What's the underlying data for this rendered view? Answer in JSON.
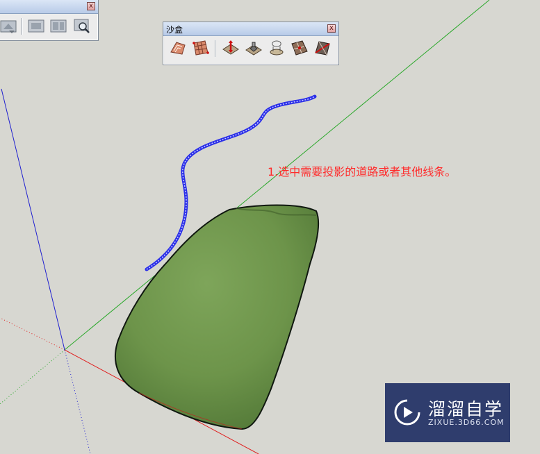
{
  "toolbars": {
    "sandbox": {
      "title": "沙盒",
      "close_glyph": "x",
      "tools": [
        {
          "name": "from-contours-tool-icon"
        },
        {
          "name": "from-scratch-tool-icon"
        },
        {
          "name": "smoove-tool-icon"
        },
        {
          "name": "stamp-tool-icon"
        },
        {
          "name": "drape-tool-icon"
        },
        {
          "name": "add-detail-tool-icon"
        },
        {
          "name": "flip-edge-tool-icon"
        }
      ]
    },
    "views": {
      "close_glyph": "x",
      "tools": [
        {
          "name": "view-tool-icon"
        },
        {
          "name": "view-tool-icon"
        },
        {
          "name": "view-tool-icon"
        },
        {
          "name": "zoom-view-tool-icon"
        }
      ]
    }
  },
  "annotation": {
    "text": "1.选中需要投影的道路或者其他线条。",
    "color": "#ff2b2b"
  },
  "watermark": {
    "title": "溜溜自学",
    "url": "ZIXUE.3D66.COM",
    "background": "#2f3d6d"
  },
  "scene": {
    "background": "#d7d7d1",
    "terrain_color": "#6d944a",
    "road_line_color": "#2a2ee8",
    "axis_colors": {
      "red": "#e01e1e",
      "green": "#2aa82a",
      "blue": "#2020d0"
    }
  }
}
